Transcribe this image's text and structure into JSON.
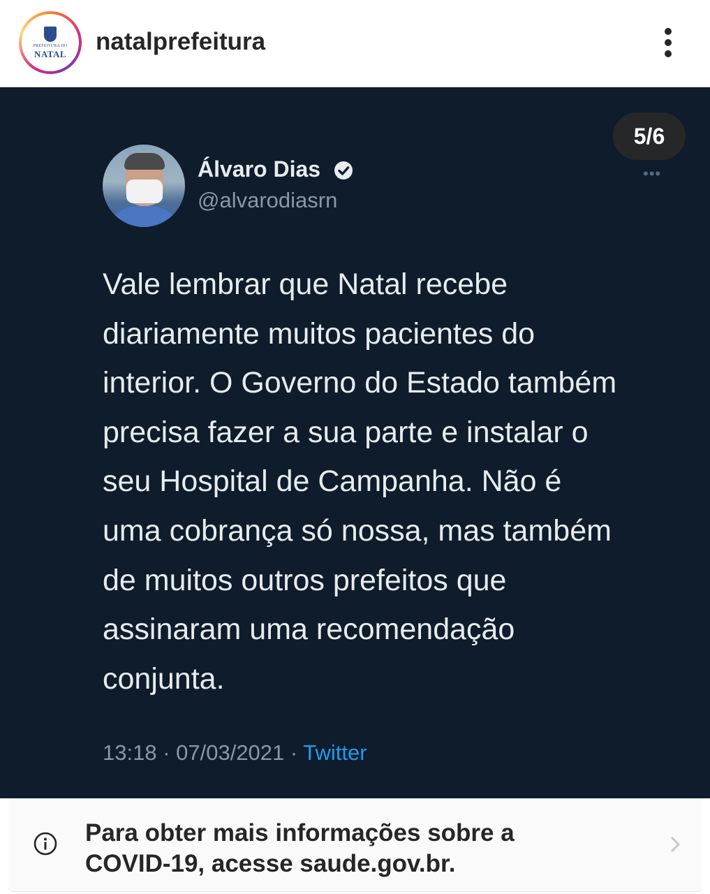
{
  "header": {
    "username": "natalprefeitura",
    "logo": {
      "small_text": "PREFEITURA DO",
      "big_text": "NATAL"
    },
    "more_icon": "more-vertical-icon"
  },
  "post": {
    "counter": "5/6",
    "tweet": {
      "author_name": "Álvaro Dias",
      "handle": "@alvarodiasrn",
      "verified_icon": "verified-badge-icon",
      "more_icon": "•••",
      "text": "Vale lembrar que Natal recebe\ndiariamente muitos pacientes do\ninterior. O Governo do Estado também\nprecisa fazer a sua parte e instalar o\nseu Hospital de Campanha. Não é\numa cobrança só nossa, mas também\nde muitos outros prefeitos que\nassinaram uma recomendação\nconjunta.",
      "meta": "13:18 · 07/03/2021 · ",
      "source": "Twitter"
    },
    "colors": {
      "background": "#0f1c2b",
      "text": "#e6ecf0",
      "muted": "#8899a6",
      "link": "#1d9bf0"
    }
  },
  "banner": {
    "text": "Para obter mais informações sobre a\nCOVID-19, acesse saude.gov.br.",
    "info_icon": "info-icon",
    "chevron_icon": "chevron-right-icon"
  }
}
